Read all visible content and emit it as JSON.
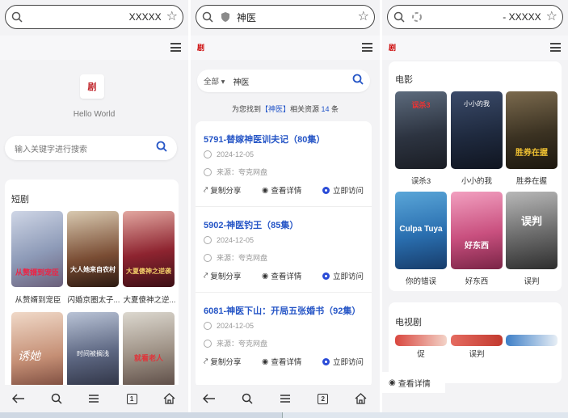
{
  "phone1": {
    "address": {
      "url": "XXXXX"
    },
    "hello": "Hello World",
    "search_placeholder": "输入关键字进行搜索",
    "section_title": "短剧",
    "posters": [
      {
        "caption": "从赘婿到宠臣",
        "art": "从赘婿到宠臣"
      },
      {
        "caption": "闪婚京圈太子...",
        "art": "大人她来自农村"
      },
      {
        "caption": "大夏傻神之逆...",
        "art": "大夏傻神之逆袭"
      },
      {
        "caption": "",
        "art": "诱她"
      },
      {
        "caption": "",
        "art": "时间被搁浅"
      },
      {
        "caption": "",
        "art": "就看老人"
      }
    ],
    "tab_count": "1"
  },
  "phone2": {
    "address": {
      "url": "神医"
    },
    "search_scope": "全部",
    "search_query": "神医",
    "found": {
      "prefix": "为您找到",
      "keyword": "【神医】",
      "middle": "相关资源",
      "count": "14",
      "suffix": "条"
    },
    "results": [
      {
        "title": "5791-替嫁神医训夫记（80集）",
        "date": "2024-12-05",
        "source": "来源：夸克网盘"
      },
      {
        "title": "5902-神医钓王（85集）",
        "date": "2024-12-05",
        "source": "来源：夸克网盘"
      },
      {
        "title": "6081-神医下山：开局五张婚书（92集）",
        "date": "2024-12-05",
        "source": "来源：夸克网盘"
      }
    ],
    "actions": {
      "share": "复制分享",
      "detail": "查看详情",
      "visit": "立即访问"
    },
    "tab_count": "2"
  },
  "phone3": {
    "address": {
      "url": "- XXXXX"
    },
    "movie_section": "电影",
    "movies": [
      {
        "caption": "误杀3",
        "art": "误杀3"
      },
      {
        "caption": "小小的我",
        "art": "小小的我"
      },
      {
        "caption": "胜券在握",
        "art": "胜券在握"
      },
      {
        "caption": "你的错误",
        "art": "Culpa Tuya"
      },
      {
        "caption": "好东西",
        "art": "好东西"
      },
      {
        "caption": "误判",
        "art": "误判"
      }
    ],
    "tv_section": "电视剧",
    "tv_items": [
      {
        "caption": "促"
      },
      {
        "caption": "误判"
      },
      {
        "caption": ""
      }
    ],
    "toast": "查看详情"
  },
  "colors": {
    "accent": "#2555c6",
    "visit_icon": "#2a4bd7"
  }
}
